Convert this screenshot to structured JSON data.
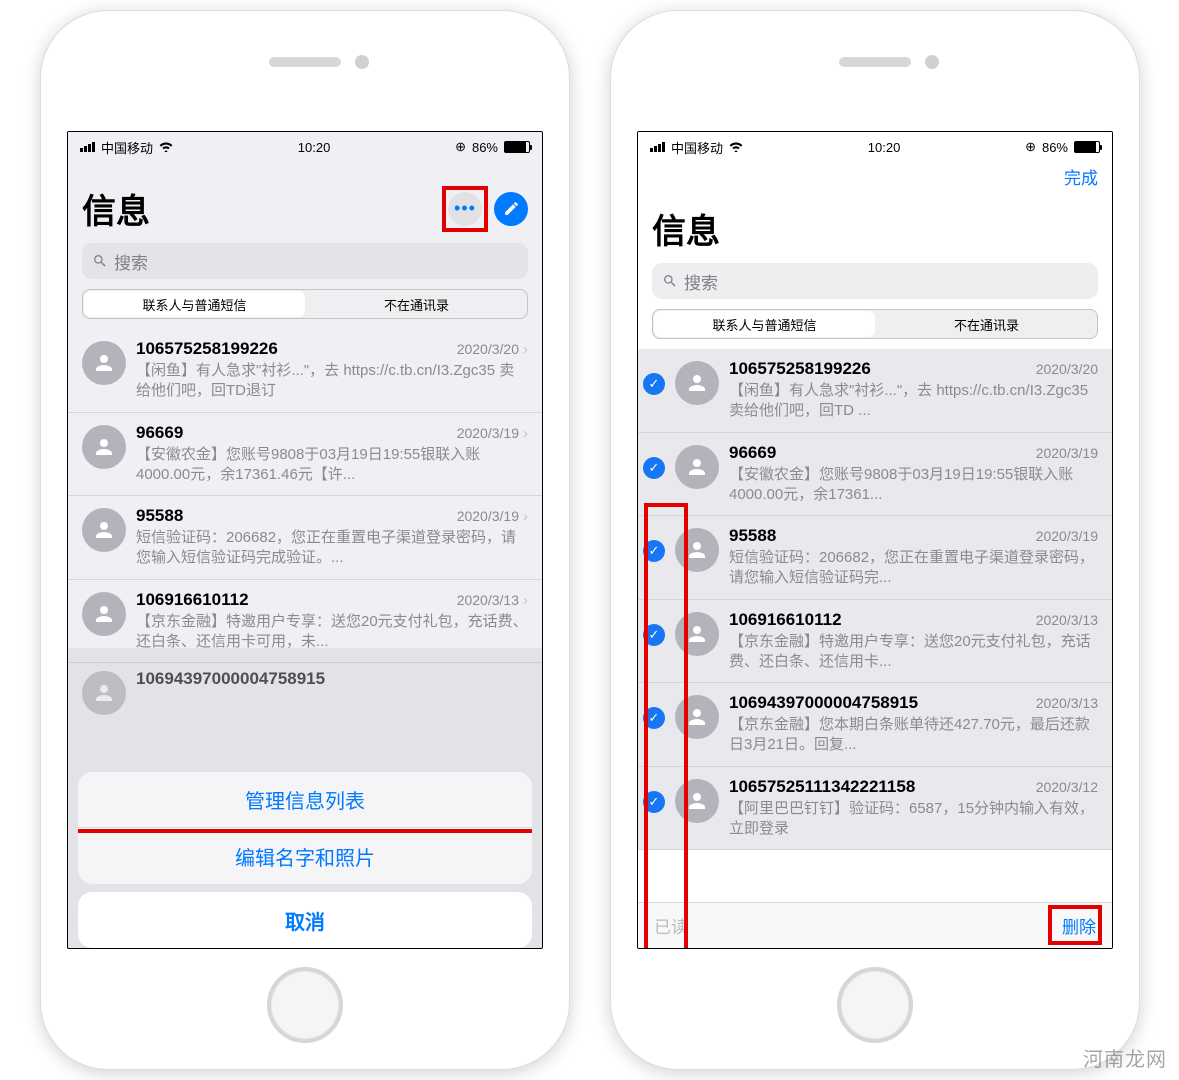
{
  "statusbar": {
    "carrier": "中国移动",
    "time": "10:20",
    "battery_pct": "86%"
  },
  "header": {
    "title": "信息",
    "done": "完成"
  },
  "search": {
    "placeholder": "搜索"
  },
  "segments": {
    "a": "联系人与普通短信",
    "b": "不在通讯录"
  },
  "left_messages": [
    {
      "sender": "106575258199226",
      "date": "2020/3/20",
      "snippet": "【闲鱼】有人急求\"衬衫...\"，去 https://c.tb.cn/I3.Zgc35 卖给他们吧，回TD退订"
    },
    {
      "sender": "96669",
      "date": "2020/3/19",
      "snippet": "【安徽农金】您账号9808于03月19日19:55银联入账4000.00元，余17361.46元【许..."
    },
    {
      "sender": "95588",
      "date": "2020/3/19",
      "snippet": "短信验证码：206682，您正在重置电子渠道登录密码，请您输入短信验证码完成验证。..."
    },
    {
      "sender": "106916610112",
      "date": "2020/3/13",
      "snippet": "【京东金融】特邀用户专享：送您20元支付礼包，充话费、还白条、还信用卡可用，未..."
    },
    {
      "sender": "10694397000004758915",
      "date": "",
      "snippet": ""
    }
  ],
  "right_messages": [
    {
      "sender": "106575258199226",
      "date": "2020/3/20",
      "snippet": "【闲鱼】有人急求\"衬衫...\"，去 https://c.tb.cn/I3.Zgc35 卖给他们吧，回TD ..."
    },
    {
      "sender": "96669",
      "date": "2020/3/19",
      "snippet": "【安徽农金】您账号9808于03月19日19:55银联入账4000.00元，余17361..."
    },
    {
      "sender": "95588",
      "date": "2020/3/19",
      "snippet": "短信验证码：206682，您正在重置电子渠道登录密码，请您输入短信验证码完..."
    },
    {
      "sender": "106916610112",
      "date": "2020/3/13",
      "snippet": "【京东金融】特邀用户专享：送您20元支付礼包，充话费、还白条、还信用卡..."
    },
    {
      "sender": "10694397000004758915",
      "date": "2020/3/13",
      "snippet": "【京东金融】您本期白条账单待还427.70元，最后还款日3月21日。回复..."
    },
    {
      "sender": "10657525111342221158",
      "date": "2020/3/12",
      "snippet": "【阿里巴巴钉钉】验证码：6587，15分钟内输入有效，立即登录"
    }
  ],
  "action_sheet": {
    "manage": "管理信息列表",
    "edit_profile": "编辑名字和照片",
    "cancel": "取消"
  },
  "toolbar": {
    "read": "已读",
    "delete": "删除"
  },
  "watermark": "河南龙网"
}
